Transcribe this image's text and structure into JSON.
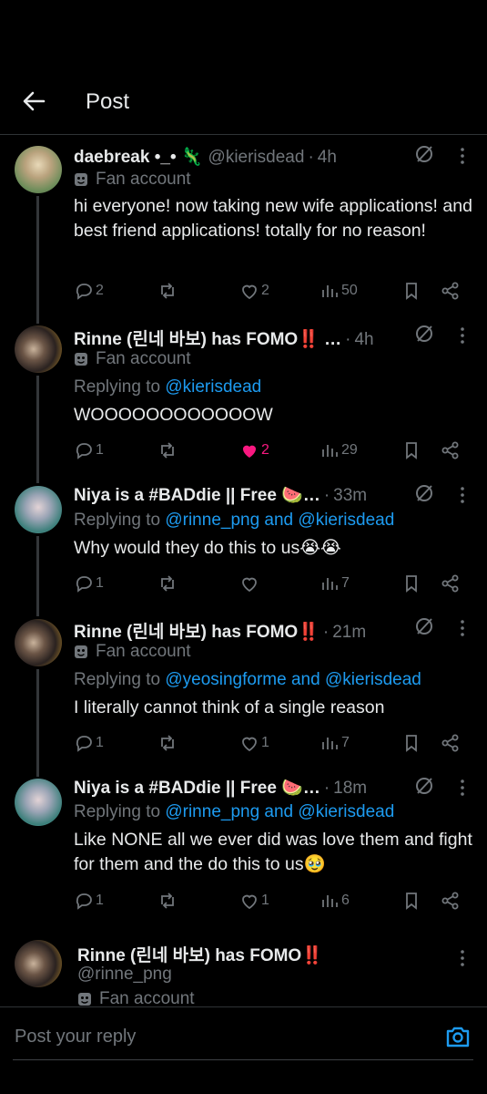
{
  "header": {
    "title": "Post"
  },
  "labels": {
    "fan_account": "Fan account",
    "replying_to": "Replying to"
  },
  "posts": [
    {
      "name": "daebreak •_• 🦎",
      "handle": "@kierisdead",
      "time": "4h",
      "text": "hi everyone! now taking new wife applications! and best friend applications! totally for no reason!",
      "replies": "2",
      "reposts": "",
      "likes": "2",
      "views": "50",
      "liked": false
    },
    {
      "name": "Rinne (린네 바보) has FOMO‼️ …",
      "time": "4h",
      "replying_to": "@kierisdead",
      "text": "WOOOOOOOOOOOOW",
      "replies": "1",
      "reposts": "",
      "likes": "2",
      "views": "29",
      "liked": true
    },
    {
      "name": "Niya is a #BADdie || Free 🍉…",
      "time": "33m",
      "replying_to": "@rinne_png and @kierisdead",
      "text": "Why would they do this to us😭😭",
      "replies": "1",
      "reposts": "",
      "likes": "",
      "views": "7",
      "liked": false
    },
    {
      "name": "Rinne (린네 바보) has FOMO‼️",
      "time": "21m",
      "replying_to": "@yeosingforme and @kierisdead",
      "text": "I literally cannot think of a single reason",
      "replies": "1",
      "reposts": "",
      "likes": "1",
      "views": "7",
      "liked": false
    },
    {
      "name": "Niya is a #BADdie || Free 🍉…",
      "time": "18m",
      "replying_to": "@rinne_png and @kierisdead",
      "text": "Like NONE all we ever did was love them and fight for them and the do this to us🥹",
      "replies": "1",
      "reposts": "",
      "likes": "1",
      "views": "6",
      "liked": false
    },
    {
      "name": "Rinne (린네 바보) has FOMO‼️",
      "handle": "@rinne_png"
    }
  ],
  "reply": {
    "placeholder": "Post your reply"
  },
  "colors": {
    "accent": "#1d9bf0",
    "like": "#f91880",
    "muted": "#71767b",
    "background": "#000000"
  }
}
